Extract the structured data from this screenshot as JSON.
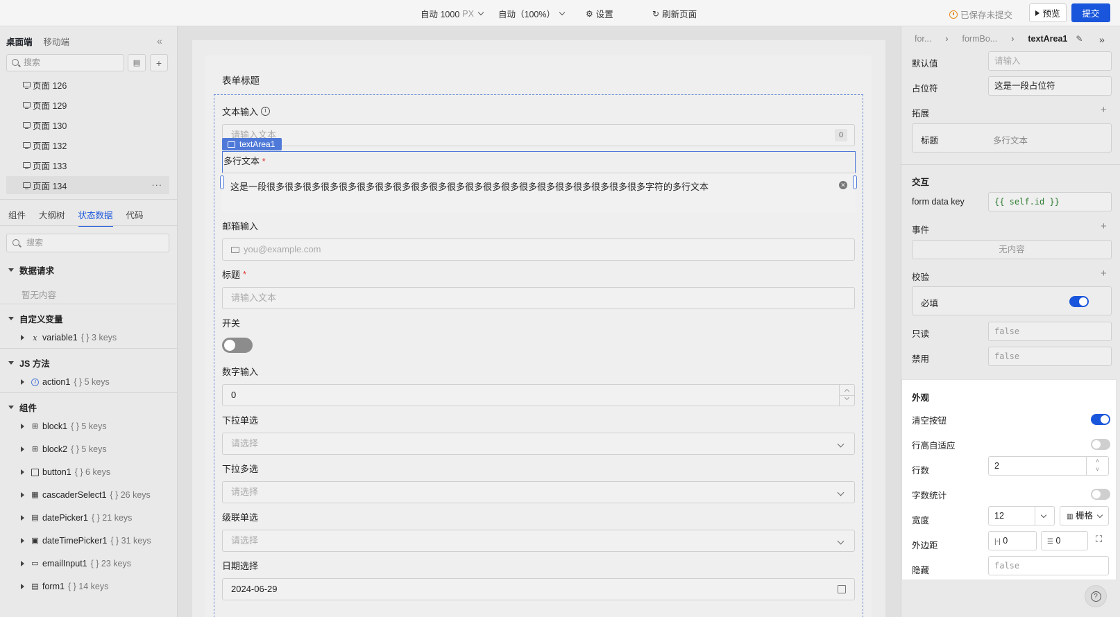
{
  "topbar": {
    "width_label": "自动 1000",
    "width_unit": "PX",
    "zoom_label": "自动（100%）",
    "settings_label": "设置",
    "refresh_label": "刷新页面",
    "unsaved_label": "已保存未提交",
    "preview_label": "预览",
    "submit_label": "提交"
  },
  "left_panel": {
    "platform_tabs": [
      "桌面端",
      "移动端"
    ],
    "search_placeholder": "搜索",
    "pages": [
      "页面 126",
      "页面 129",
      "页面 130",
      "页面 132",
      "页面 133",
      "页面 134"
    ],
    "more_label": "···",
    "section_tabs": [
      "组件",
      "大纲树",
      "状态数据",
      "代码"
    ],
    "state_search_placeholder": "搜索",
    "groups": {
      "data_request": "数据请求",
      "data_request_empty": "暂无内容",
      "custom_vars": "自定义变量",
      "js_methods": "JS 方法",
      "components": "组件"
    },
    "variables": [
      {
        "name": "variable1",
        "meta": "{ } 3 keys"
      }
    ],
    "actions": [
      {
        "name": "action1",
        "meta": "{ } 5 keys"
      }
    ],
    "component_nodes": [
      {
        "name": "block1",
        "meta": "{ } 5 keys"
      },
      {
        "name": "block2",
        "meta": "{ } 5 keys"
      },
      {
        "name": "button1",
        "meta": "{ } 6 keys"
      },
      {
        "name": "cascaderSelect1",
        "meta": "{ } 26 keys"
      },
      {
        "name": "datePicker1",
        "meta": "{ } 21 keys"
      },
      {
        "name": "dateTimePicker1",
        "meta": "{ } 31 keys"
      },
      {
        "name": "emailInput1",
        "meta": "{ } 23 keys"
      },
      {
        "name": "form1",
        "meta": "{ } 14 keys"
      }
    ]
  },
  "canvas": {
    "form_title": "表单标题",
    "selected_tag": "textArea1",
    "fields": {
      "text": {
        "label": "文本输入",
        "placeholder": "请输入文本",
        "count": "0"
      },
      "textarea": {
        "label": "多行文本",
        "required": "*",
        "value": "这是一段很多很多很多很多很多很多很多很多很多很多很多很多很多很多很多很多很多很多很多很多很多字符的多行文本"
      },
      "email": {
        "label": "邮箱输入",
        "placeholder": "you@example.com"
      },
      "title": {
        "label": "标题",
        "required": "*",
        "placeholder": "请输入文本"
      },
      "switch": {
        "label": "开关"
      },
      "number": {
        "label": "数字输入",
        "value": "0"
      },
      "select": {
        "label": "下拉单选",
        "placeholder": "请选择"
      },
      "multiselect": {
        "label": "下拉多选",
        "placeholder": "请选择"
      },
      "cascader": {
        "label": "级联单选",
        "placeholder": "请选择"
      },
      "date": {
        "label": "日期选择",
        "value": "2024-06-29"
      }
    }
  },
  "right_panel": {
    "breadcrumb": [
      "for...",
      "formBo...",
      "textArea1"
    ],
    "default_value": {
      "label": "默认值",
      "placeholder": "请输入"
    },
    "placeholder_field": {
      "label": "占位符",
      "value": "这是一段占位符"
    },
    "extend": {
      "label": "拓展",
      "key": "标题",
      "value": "多行文本"
    },
    "interaction": {
      "label": "交互",
      "form_key_label": "form data key",
      "form_key_value": "{{ self.id }}"
    },
    "events": {
      "label": "事件",
      "empty": "无内容"
    },
    "validation": {
      "label": "校验",
      "required_label": "必填",
      "required_on": true
    },
    "readonly": {
      "label": "只读",
      "value": "false"
    },
    "disabled": {
      "label": "禁用",
      "value": "false"
    },
    "appearance": {
      "title": "外观",
      "clear_button": {
        "label": "清空按钮",
        "on": true
      },
      "auto_height": {
        "label": "行高自适应",
        "on": false
      },
      "rows": {
        "label": "行数",
        "value": "2"
      },
      "char_count": {
        "label": "字数统计",
        "on": false
      },
      "width": {
        "label": "宽度",
        "value": "12",
        "mode": "栅格"
      },
      "margin": {
        "label": "外边距",
        "horizontal": "0",
        "vertical": "0"
      },
      "hidden": {
        "label": "隐藏",
        "value": "false"
      }
    }
  },
  "colors": {
    "accent": "#1a56db",
    "required": "#e0362b",
    "selection": "#4f79d8"
  }
}
